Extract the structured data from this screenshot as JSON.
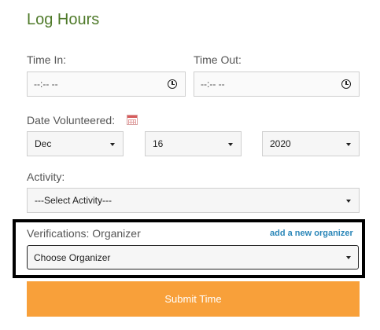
{
  "form": {
    "title": "Log Hours",
    "time_in": {
      "label": "Time In:",
      "value": "--:-- --"
    },
    "time_out": {
      "label": "Time Out:",
      "value": "--:-- --"
    },
    "date": {
      "label": "Date Volunteered:",
      "month": "Dec",
      "day": "16",
      "year": "2020"
    },
    "activity": {
      "label": "Activity:",
      "selected": "---Select Activity---"
    },
    "verifications": {
      "label": "Verifications: Organizer",
      "add_link": "add a new organizer",
      "selected": "Choose Organizer"
    },
    "submit_label": "Submit Time"
  },
  "colors": {
    "title": "#4f7a2a",
    "link": "#2a86b8",
    "submit_bg": "#f8a03a"
  }
}
